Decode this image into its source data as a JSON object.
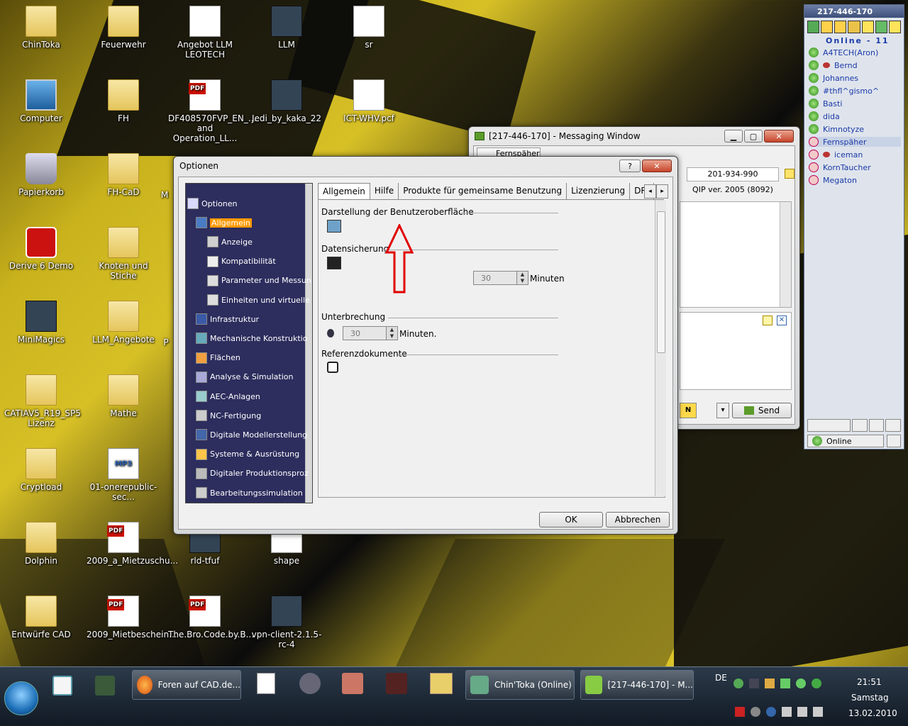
{
  "desktop_icons": [
    {
      "label": "ChinToka",
      "kind": "folder"
    },
    {
      "label": "Feuerwehr",
      "kind": "folder"
    },
    {
      "label": "Angebot LLM LEOTECH",
      "kind": "doc"
    },
    {
      "label": "LLM",
      "kind": "app"
    },
    {
      "label": "sr",
      "kind": "doc"
    },
    {
      "label": "Computer",
      "kind": "computer"
    },
    {
      "label": "FH",
      "kind": "folder"
    },
    {
      "label": "DF408570FVP_EN_... and Operation_LL...",
      "kind": "pdf"
    },
    {
      "label": "Jedi_by_kaka_22",
      "kind": "app"
    },
    {
      "label": "ICT-WHV.pcf",
      "kind": "doc"
    },
    {
      "label": "Papierkorb",
      "kind": "bin"
    },
    {
      "label": "FH-CaD",
      "kind": "folder"
    },
    {
      "label": "Derive 6 Demo",
      "kind": "redapp"
    },
    {
      "label": "Knoten und Stiche",
      "kind": "folder"
    },
    {
      "label": "MiniMagics",
      "kind": "app"
    },
    {
      "label": "LLM_Angebote",
      "kind": "folder"
    },
    {
      "label": "CATIAV5_R19_SP5 Lizenz",
      "kind": "folder"
    },
    {
      "label": "Mathe",
      "kind": "folder"
    },
    {
      "label": "Cryptload",
      "kind": "folder"
    },
    {
      "label": "01-onerepublic-sec...",
      "kind": "mp3"
    },
    {
      "label": "Dolphin",
      "kind": "folder"
    },
    {
      "label": "2009_a_Mietzuschu...",
      "kind": "pdf"
    },
    {
      "label": "rld-tfuf",
      "kind": "app"
    },
    {
      "label": "shape",
      "kind": "doc"
    },
    {
      "label": "Entwürfe CAD",
      "kind": "folder"
    },
    {
      "label": "2009_Mietbeschein...",
      "kind": "pdf"
    },
    {
      "label": "The.Bro.Code.by.B...",
      "kind": "pdf"
    },
    {
      "label": "vpn-client-2.1.5-rc-4",
      "kind": "app"
    }
  ],
  "desktop_partial_labels": {
    "m": "M",
    "p": "P"
  },
  "mp3_badge": "MP3",
  "options_dialog": {
    "title": "Optionen",
    "help_glyph": "?",
    "close_glyph": "✕",
    "tree": [
      {
        "label": "Optionen",
        "level": 0,
        "icon": "options-icon"
      },
      {
        "label": "Allgemein",
        "level": 1,
        "icon": "general-icon",
        "selected": true
      },
      {
        "label": "Anzeige",
        "level": 2,
        "icon": "display-icon"
      },
      {
        "label": "Kompatibilität",
        "level": 2,
        "icon": "compatibility-icon"
      },
      {
        "label": "Parameter und Messun",
        "level": 2,
        "icon": "parameters-icon"
      },
      {
        "label": "Einheiten und virtuelle",
        "level": 2,
        "icon": "units-icon"
      },
      {
        "label": "Infrastruktur",
        "level": 1,
        "icon": "infrastructure-icon"
      },
      {
        "label": "Mechanische Konstruktio",
        "level": 1,
        "icon": "mechanical-icon"
      },
      {
        "label": "Flächen",
        "level": 1,
        "icon": "surfaces-icon"
      },
      {
        "label": "Analyse & Simulation",
        "level": 1,
        "icon": "analysis-icon"
      },
      {
        "label": "AEC-Anlagen",
        "level": 1,
        "icon": "aec-icon"
      },
      {
        "label": "NC-Fertigung",
        "level": 1,
        "icon": "nc-icon"
      },
      {
        "label": "Digitale Modellerstellung",
        "level": 1,
        "icon": "digital-model-icon"
      },
      {
        "label": "Systeme & Ausrüstung",
        "level": 1,
        "icon": "systems-icon"
      },
      {
        "label": "Digitaler Produktionsproz",
        "level": 1,
        "icon": "production-icon"
      },
      {
        "label": "Bearbeitungssimulation",
        "level": 1,
        "icon": "machining-icon"
      }
    ],
    "tabs": [
      "Allgemein",
      "Hilfe",
      "Produkte für gemeinsame Benutzung",
      "Lizenzierung",
      "DRI"
    ],
    "active_tab": "Allgemein",
    "sections": {
      "ui": "Darstellung der Benutzeroberfläche",
      "backup": "Datensicherung",
      "backup_value": "30",
      "backup_unit": "Minuten",
      "interrupt": "Unterbrechung",
      "interrupt_value": "30",
      "interrupt_unit": "Minuten.",
      "refdocs": "Referenzdokumente"
    },
    "ok_label": "OK",
    "cancel_label": "Abbrechen"
  },
  "messaging_window": {
    "title": "[217-446-170] - Messaging Window",
    "tab_label": "Fernspäher",
    "uin_value": "201-934-990",
    "client_version": "QIP ver. 2005 (8092)",
    "send_label": "Send",
    "n_glyph": "N",
    "dropdown_glyph": "▾"
  },
  "qip": {
    "title": "217-446-170",
    "online_header": "Online - 11",
    "contacts": [
      {
        "name": "A4TECH(Aron)",
        "status": "online"
      },
      {
        "name": "Bernd",
        "status": "online-eye"
      },
      {
        "name": "Johannes",
        "status": "online"
      },
      {
        "name": "#thfl^gismo^",
        "status": "online"
      },
      {
        "name": "Basti",
        "status": "online"
      },
      {
        "name": "dida",
        "status": "online"
      },
      {
        "name": "Kimnotyze",
        "status": "online"
      },
      {
        "name": "Fernspäher",
        "status": "na",
        "selected": true
      },
      {
        "name": "iceman",
        "status": "na-eye"
      },
      {
        "name": "KornTaucher",
        "status": "na"
      },
      {
        "name": "Megaton",
        "status": "na"
      }
    ],
    "status_label": "Online"
  },
  "taskbar": {
    "items": [
      {
        "label": "Foren auf CAD.de...",
        "icon": "firefox-icon"
      },
      {
        "label": "Chin'Toka (Online)",
        "icon": "contacts-icon"
      },
      {
        "label": "[217-446-170] - M...",
        "icon": "messaging-icon"
      }
    ],
    "language": "DE",
    "time": "21:51",
    "day": "Samstag",
    "date": "13.02.2010"
  },
  "colors": {
    "tree_bg": "#2d2d5e",
    "tree_selected": "#ff9a00",
    "arrow": "#e00000"
  }
}
